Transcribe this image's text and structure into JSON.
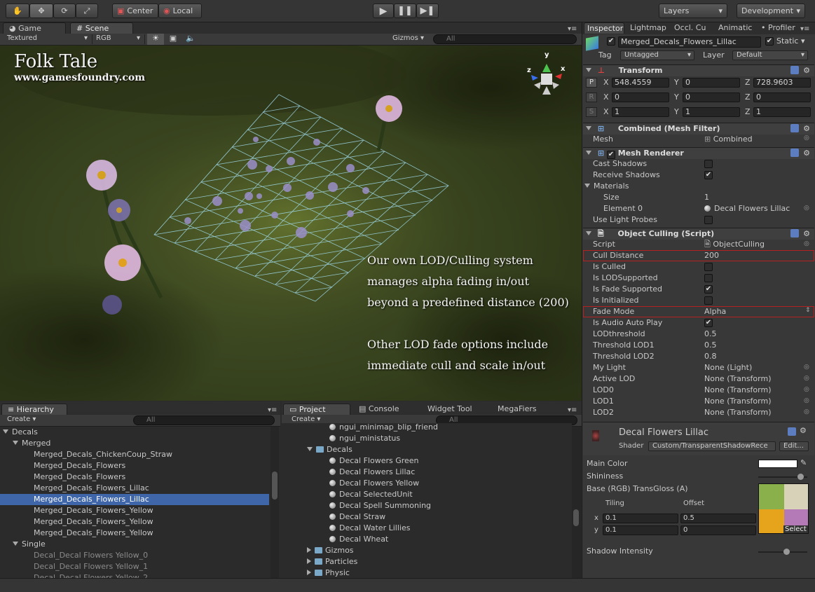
{
  "toolbar": {
    "center": "Center",
    "local": "Local",
    "layers": "Layers",
    "layout": "Development"
  },
  "scene_tabs": {
    "game": "Game",
    "scene": "Scene"
  },
  "scene_bar": {
    "render_mode": "Textured",
    "color_mode": "RGB",
    "gizmos": "Gizmos",
    "search_placeholder": "All"
  },
  "overlay": {
    "title": "Folk Tale",
    "url": "www.gamesfoundry.com",
    "para1": [
      "Our own LOD/Culling system",
      "manages alpha fading in/out",
      "beyond a predefined distance (200)"
    ],
    "para2": [
      "Other LOD fade options include",
      "immediate cull and scale in/out"
    ]
  },
  "gizmo": {
    "y": "y",
    "x": "x",
    "z": "z"
  },
  "hierarchy": {
    "tab": "Hierarchy",
    "create": "Create",
    "search": "All",
    "items": [
      {
        "label": "Decals",
        "indent": 0,
        "kind": "root"
      },
      {
        "label": "Merged",
        "indent": 1,
        "kind": "open"
      },
      {
        "label": "Merged_Decals_ChickenCoup_Straw",
        "indent": 2,
        "kind": "leaf"
      },
      {
        "label": "Merged_Decals_Flowers",
        "indent": 2,
        "kind": "leaf"
      },
      {
        "label": "Merged_Decals_Flowers",
        "indent": 2,
        "kind": "leaf"
      },
      {
        "label": "Merged_Decals_Flowers_Lillac",
        "indent": 2,
        "kind": "leaf"
      },
      {
        "label": "Merged_Decals_Flowers_Lillac",
        "indent": 2,
        "kind": "selected"
      },
      {
        "label": "Merged_Decals_Flowers_Yellow",
        "indent": 2,
        "kind": "leaf"
      },
      {
        "label": "Merged_Decals_Flowers_Yellow",
        "indent": 2,
        "kind": "leaf"
      },
      {
        "label": "Merged_Decals_Flowers_Yellow",
        "indent": 2,
        "kind": "leaf"
      },
      {
        "label": "Single",
        "indent": 1,
        "kind": "open"
      },
      {
        "label": "Decal_Decal Flowers Yellow_0",
        "indent": 2,
        "kind": "dim"
      },
      {
        "label": "Decal_Decal Flowers Yellow_1",
        "indent": 2,
        "kind": "dim"
      },
      {
        "label": "Decal_Decal Flowers Yellow_2",
        "indent": 2,
        "kind": "dim"
      }
    ]
  },
  "project": {
    "tabs": [
      "Project",
      "Console",
      "Widget Tool",
      "MegaFiers"
    ],
    "create": "Create",
    "search": "All",
    "items": [
      {
        "label": "ngui_minimap_blip_friend",
        "indent": 2,
        "kind": "asset"
      },
      {
        "label": "ngui_ministatus",
        "indent": 2,
        "kind": "asset"
      },
      {
        "label": "Decals",
        "indent": 1,
        "kind": "folder-open"
      },
      {
        "label": "Decal Flowers Green",
        "indent": 2,
        "kind": "asset"
      },
      {
        "label": "Decal Flowers Lillac",
        "indent": 2,
        "kind": "asset"
      },
      {
        "label": "Decal Flowers Yellow",
        "indent": 2,
        "kind": "asset"
      },
      {
        "label": "Decal SelectedUnit",
        "indent": 2,
        "kind": "asset"
      },
      {
        "label": "Decal Spell Summoning",
        "indent": 2,
        "kind": "asset"
      },
      {
        "label": "Decal Straw",
        "indent": 2,
        "kind": "asset"
      },
      {
        "label": "Decal Water Lillies",
        "indent": 2,
        "kind": "asset"
      },
      {
        "label": "Decal Wheat",
        "indent": 2,
        "kind": "asset"
      },
      {
        "label": "Gizmos",
        "indent": 1,
        "kind": "folder"
      },
      {
        "label": "Particles",
        "indent": 1,
        "kind": "folder"
      },
      {
        "label": "Physic",
        "indent": 1,
        "kind": "folder"
      }
    ]
  },
  "inspector": {
    "tabs": [
      "Inspector",
      "Lightmap",
      "Occl. Cu",
      "Animatic",
      "Profiler"
    ],
    "object_name": "Merged_Decals_Flowers_Lillac",
    "static": "Static",
    "tag_label": "Tag",
    "tag": "Untagged",
    "layer_label": "Layer",
    "layer": "Default",
    "transform": {
      "title": "Transform",
      "position": {
        "x": "548.4559",
        "y": "0",
        "z": "728.9603"
      },
      "rotation": {
        "x": "0",
        "y": "0",
        "z": "0"
      },
      "scale": {
        "x": "1",
        "y": "1",
        "z": "1"
      }
    },
    "mesh_filter": {
      "title": "Combined (Mesh Filter)",
      "mesh_label": "Mesh",
      "mesh": "Combined"
    },
    "mesh_renderer": {
      "title": "Mesh Renderer",
      "cast": "Cast Shadows",
      "receive": "Receive Shadows",
      "materials": "Materials",
      "size_label": "Size",
      "size": "1",
      "element_label": "Element 0",
      "element": "Decal Flowers Lillac",
      "probes": "Use Light Probes"
    },
    "culling": {
      "title": "Object Culling (Script)",
      "rows": [
        {
          "label": "Script",
          "value": "ObjectCulling",
          "type": "obj"
        },
        {
          "label": "Cull Distance",
          "value": "200",
          "type": "text",
          "hl": true
        },
        {
          "label": "Is Culled",
          "value": "",
          "type": "chk"
        },
        {
          "label": "Is LODSupported",
          "value": "",
          "type": "chk"
        },
        {
          "label": "Is Fade Supported",
          "value": "✔",
          "type": "chk"
        },
        {
          "label": "Is Initialized",
          "value": "",
          "type": "chk"
        },
        {
          "label": "Fade Mode",
          "value": "Alpha",
          "type": "enum",
          "hl": true
        },
        {
          "label": "Is Audio Auto Play",
          "value": "✔",
          "type": "chk"
        },
        {
          "label": "LODthreshold",
          "value": "0.5",
          "type": "text"
        },
        {
          "label": "Threshold LOD1",
          "value": "0.5",
          "type": "text"
        },
        {
          "label": "Threshold LOD2",
          "value": "0.8",
          "type": "text"
        },
        {
          "label": "My Light",
          "value": "None (Light)",
          "type": "obj"
        },
        {
          "label": "Active LOD",
          "value": "None (Transform)",
          "type": "obj"
        },
        {
          "label": "LOD0",
          "value": "None (Transform)",
          "type": "obj"
        },
        {
          "label": "LOD1",
          "value": "None (Transform)",
          "type": "obj"
        },
        {
          "label": "LOD2",
          "value": "None (Transform)",
          "type": "obj"
        }
      ]
    },
    "material": {
      "name": "Decal Flowers Lillac",
      "shader_label": "Shader",
      "shader": "Custom/TransparentShadowRece",
      "edit": "Edit...",
      "main_color": "Main Color",
      "shininess": "Shininess",
      "base": "Base (RGB) TransGloss (A)",
      "tiling": "Tiling",
      "offset": "Offset",
      "x_label": "x",
      "y_label": "y",
      "tile_x": "0.1",
      "tile_y": "0.1",
      "off_x": "0.5",
      "off_y": "0",
      "select": "Select",
      "shadow": "Shadow Intensity"
    }
  }
}
